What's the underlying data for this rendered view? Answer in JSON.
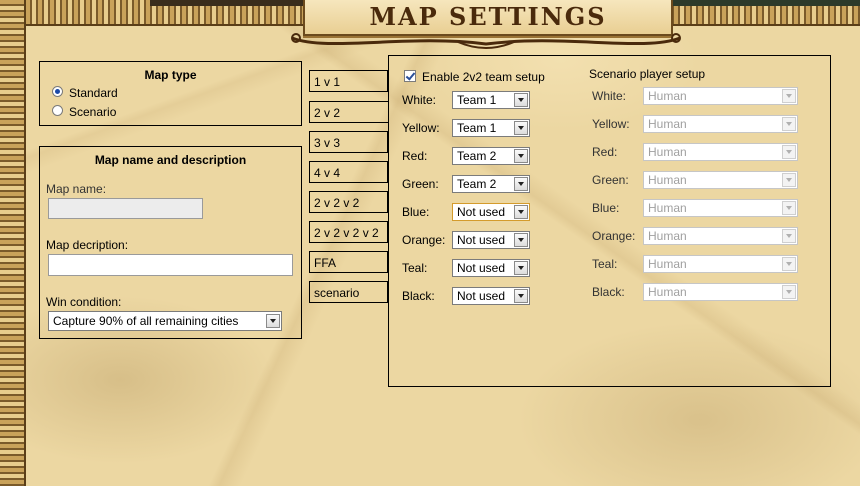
{
  "title": "Map settings",
  "map_type": {
    "heading": "Map type",
    "options": [
      {
        "label": "Standard",
        "selected": true
      },
      {
        "label": "Scenario",
        "selected": false
      }
    ]
  },
  "map_name_desc": {
    "heading": "Map name and description",
    "name_label": "Map name:",
    "name_value": "",
    "desc_label": "Map decription:",
    "desc_value": "",
    "win_label": "Win condition:",
    "win_value": "Capture 90% of all remaining cities"
  },
  "tabs": [
    "1 v 1",
    "2 v 2",
    "3 v 3",
    "4 v 4",
    "2 v 2 v 2",
    "2 v 2 v 2 v 2",
    "FFA",
    "scenario"
  ],
  "team_setup": {
    "enable_label": "Enable 2v2 team setup",
    "enabled": true,
    "rows": [
      {
        "color": "White:",
        "value": "Team 1"
      },
      {
        "color": "Yellow:",
        "value": "Team 1"
      },
      {
        "color": "Red:",
        "value": "Team 2"
      },
      {
        "color": "Green:",
        "value": "Team 2"
      },
      {
        "color": "Blue:",
        "value": "Not used"
      },
      {
        "color": "Orange:",
        "value": "Not used"
      },
      {
        "color": "Teal:",
        "value": "Not used"
      },
      {
        "color": "Black:",
        "value": "Not used"
      }
    ]
  },
  "scenario_setup": {
    "heading": "Scenario player setup",
    "rows": [
      {
        "color": "White:",
        "value": "Human"
      },
      {
        "color": "Yellow:",
        "value": "Human"
      },
      {
        "color": "Red:",
        "value": "Human"
      },
      {
        "color": "Green:",
        "value": "Human"
      },
      {
        "color": "Blue:",
        "value": "Human"
      },
      {
        "color": "Orange:",
        "value": "Human"
      },
      {
        "color": "Teal:",
        "value": "Human"
      },
      {
        "color": "Black:",
        "value": "Human"
      }
    ]
  },
  "colors": {
    "accent": "#d49b2c",
    "border": "#5a3e18",
    "parchment": "#ecd7a2"
  }
}
